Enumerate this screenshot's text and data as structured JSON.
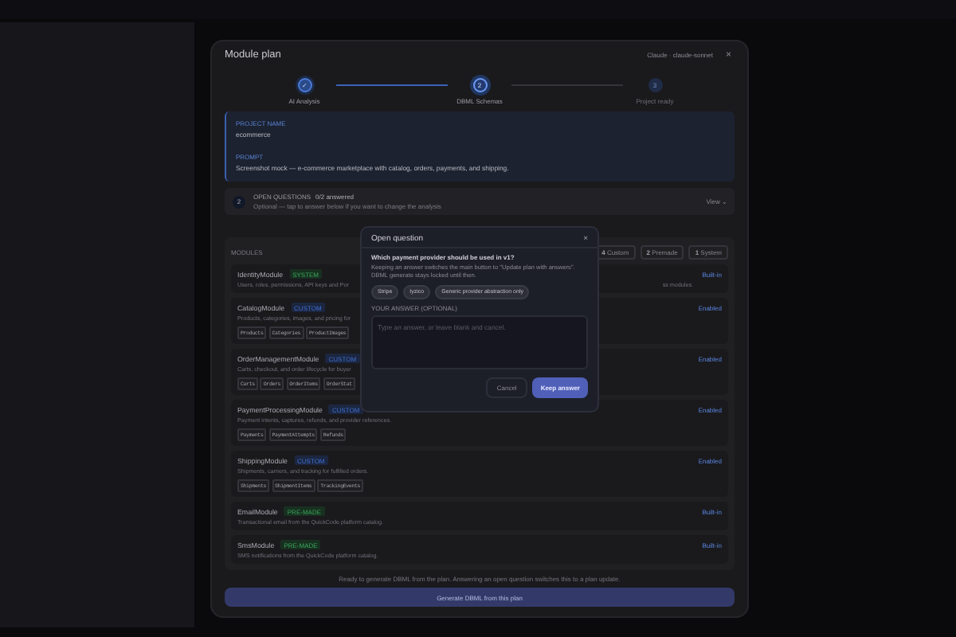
{
  "modal": {
    "title": "Module plan",
    "model": "Claude · claude-sonnet",
    "close": "×"
  },
  "steps": [
    {
      "label": "AI Analysis",
      "completed": true,
      "selected": false,
      "marker": "✓"
    },
    {
      "label": "DBML Schemas",
      "completed": false,
      "selected": true,
      "marker": "2"
    },
    {
      "label": "Project ready",
      "completed": false,
      "selected": false,
      "marker": "3"
    }
  ],
  "project": {
    "name_label": "PROJECT NAME",
    "name": "ecommerce",
    "prompt_label": "PROMPT",
    "prompt": "Screenshot mock — e-commerce marketplace with catalog, orders, payments, and shipping."
  },
  "open_questions": {
    "count": "2",
    "title": "OPEN QUESTIONS",
    "progress": "0/2 answered",
    "hint": "Optional — tap to answer below if you want to change the analysis",
    "toggle": "View ⌄"
  },
  "modules": {
    "title": "MODULES",
    "counts": [
      {
        "number": "4",
        "label": "Custom"
      },
      {
        "number": "2",
        "label": "Premade"
      },
      {
        "number": "1",
        "label": "System"
      }
    ],
    "items": [
      {
        "name": "IdentityModule",
        "tag": "SYSTEM",
        "kind": "system",
        "description": "Users, roles, permissions, API keys and Por",
        "tail": "ss modules.",
        "action": "Built-in"
      },
      {
        "name": "CatalogModule",
        "tag": "CUSTOM",
        "kind": "custom",
        "description": "Products, categories, images, and pricing for",
        "tables": [
          "Products",
          "Categories",
          "ProductImages"
        ],
        "action": "Enabled"
      },
      {
        "name": "OrderManagementModule",
        "tag": "CUSTOM",
        "kind": "custom",
        "description": "Carts, checkout, and order lifecycle for buyer",
        "tables": [
          "Carts",
          "Orders",
          "OrderItems",
          "OrderStat"
        ],
        "action": "Enabled"
      },
      {
        "name": "PaymentProcessingModule",
        "tag": "CUSTOM",
        "kind": "custom",
        "description": "Payment intents, captures, refunds, and provider references.",
        "tables": [
          "Payments",
          "PaymentAttempts",
          "Refunds"
        ],
        "action": "Enabled"
      },
      {
        "name": "ShippingModule",
        "tag": "CUSTOM",
        "kind": "custom",
        "description": "Shipments, carriers, and tracking for fulfilled orders.",
        "tables": [
          "Shipments",
          "ShipmentItems",
          "TrackingEvents"
        ],
        "action": "Enabled"
      },
      {
        "name": "EmailModule",
        "tag": "PRE-MADE",
        "kind": "premade",
        "description": "Transactional email from the QuickCode platform catalog.",
        "action": "Built-in"
      },
      {
        "name": "SmsModule",
        "tag": "PRE-MADE",
        "kind": "premade",
        "description": "SMS notifications from the QuickCode platform catalog.",
        "action": "Built-in"
      }
    ]
  },
  "footer": {
    "note": "Ready to generate DBML from the plan. Answering an open question switches this to a plan update.",
    "button": "Generate DBML from this plan"
  },
  "dialog": {
    "title": "Open question",
    "close": "×",
    "question": "Which payment provider should be used in v1?",
    "body": "Keeping an answer switches the main button to \"Update plan with answers\". DBML generate stays locked until then.",
    "options": [
      {
        "label": "Stripe",
        "selected": false
      },
      {
        "label": "Iyzico",
        "selected": false
      },
      {
        "label": "Generic provider abstraction only",
        "selected": false
      }
    ],
    "answer_label": "YOUR ANSWER (OPTIONAL)",
    "placeholder": "Type an answer, or leave blank and cancel.",
    "cancel": "Cancel",
    "confirm": "Keep answer"
  }
}
